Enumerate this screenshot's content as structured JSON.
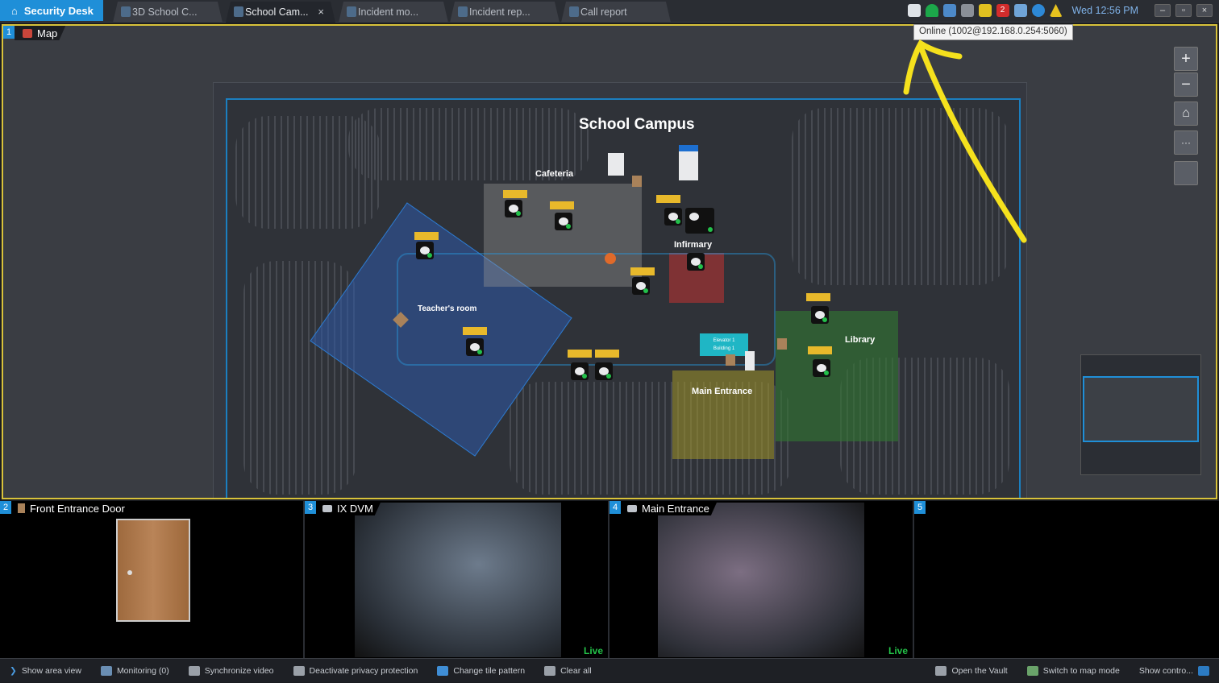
{
  "app": {
    "name": "Security Desk"
  },
  "tabs": [
    {
      "label": "3D School C...",
      "active": false
    },
    {
      "label": "School Cam...",
      "active": true,
      "close": "×"
    },
    {
      "label": "Incident mo...",
      "active": false
    },
    {
      "label": "Incident rep...",
      "active": false
    },
    {
      "label": "Call report",
      "active": false
    }
  ],
  "tray": {
    "alarm_count": "2",
    "clock": "Wed 12:56 PM"
  },
  "tooltip": {
    "text": "Online (1002@192.168.0.254:5060)"
  },
  "map_tile": {
    "number": "1",
    "label": "Map",
    "title": "School Campus",
    "zones": [
      {
        "label": "Cafeteria"
      },
      {
        "label": "Infirmary"
      },
      {
        "label": "Teacher's room"
      },
      {
        "label": "Library"
      },
      {
        "label": "Main Entrance"
      }
    ],
    "elevator": {
      "line1": "Elevator 1",
      "line2": "Building 1"
    },
    "controls": {
      "zoom_in": "+",
      "zoom_out": "−",
      "home": "⌂",
      "more": "···"
    }
  },
  "video_tiles": [
    {
      "number": "2",
      "label": "Front Entrance Door",
      "live": ""
    },
    {
      "number": "3",
      "label": "IX DVM",
      "live": "Live"
    },
    {
      "number": "4",
      "label": "Main Entrance",
      "live": "Live"
    },
    {
      "number": "5",
      "label": "",
      "live": ""
    }
  ],
  "toolbar": {
    "left": [
      {
        "label": "Show area view"
      },
      {
        "label": "Monitoring (0)"
      },
      {
        "label": "Synchronize video"
      },
      {
        "label": "Deactivate privacy protection"
      },
      {
        "label": "Change tile pattern"
      },
      {
        "label": "Clear all"
      }
    ],
    "right": [
      {
        "label": "Open the Vault"
      },
      {
        "label": "Switch to map mode"
      },
      {
        "label": "Show contro..."
      }
    ]
  },
  "colors": {
    "accent": "#1f8fd8",
    "selected_tile_border": "#d8c23a",
    "live": "#23c248",
    "annotation": "#f5e11d"
  }
}
